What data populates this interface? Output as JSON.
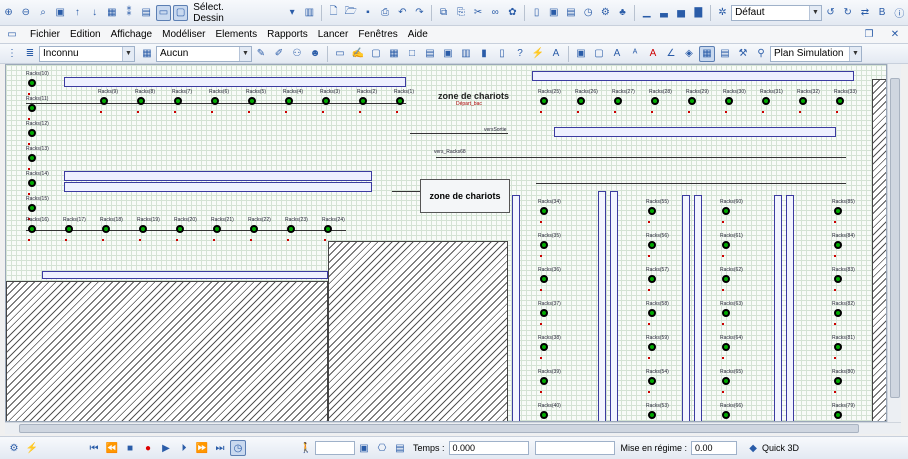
{
  "toolbar1": {
    "select_mode": "Sélect. Dessin",
    "view_combo": "Défaut"
  },
  "menu": [
    "Fichier",
    "Edition",
    "Affichage",
    "Modéliser",
    "Elements",
    "Rapports",
    "Lancer",
    "Fenêtres",
    "Aide"
  ],
  "toolbar2": {
    "layer": "Inconnu",
    "pattern": "Aucun",
    "plan": "Plan Simulation"
  },
  "canvas": {
    "zone_top": "zone de chariots",
    "zone_box": "zone de chariots",
    "label_depart": "Départ_bac",
    "label_vers_sortie": "versSortie",
    "label_vers_racks": "vers_Racks68",
    "left_racks": [
      "Racks(10)",
      "Racks(11)",
      "Racks(12)",
      "Racks(13)",
      "Racks(14)",
      "Racks(15)"
    ],
    "top_row": [
      "Racks(9)",
      "Racks(8)",
      "Racks(7)",
      "Racks(6)",
      "Racks(5)",
      "Racks(4)",
      "Racks(3)",
      "Racks(2)",
      "Racks(1)"
    ],
    "top_right_row": [
      "Racks(25)",
      "Racks(26)",
      "Racks(27)",
      "Racks(28)",
      "Racks(29)",
      "Racks(30)",
      "Racks(31)",
      "Racks(32)",
      "Racks(33)"
    ],
    "mid_row": [
      "Racks(16)",
      "Racks(17)",
      "Racks(18)",
      "Racks(19)",
      "Racks(20)",
      "Racks(21)",
      "Racks(22)",
      "Racks(23)",
      "Racks(24)"
    ],
    "col_a": [
      "Racks(34)",
      "Racks(35)",
      "Racks(36)",
      "Racks(37)",
      "Racks(38)",
      "Racks(39)",
      "Racks(40)"
    ],
    "col_b": [
      "Racks(55)",
      "Racks(56)",
      "Racks(57)",
      "Racks(58)",
      "Racks(59)",
      "Racks(54)",
      "Racks(53)"
    ],
    "col_c": [
      "Racks(60)",
      "Racks(61)",
      "Racks(62)",
      "Racks(63)",
      "Racks(64)",
      "Racks(65)",
      "Racks(66)"
    ],
    "col_d": [
      "Racks(85)",
      "Racks(84)",
      "Racks(83)",
      "Racks(82)",
      "Racks(81)",
      "Racks(80)",
      "Racks(79)"
    ]
  },
  "status": {
    "time_label": "Temps :",
    "time_value": "0.000",
    "warmup_label": "Mise en régime :",
    "warmup_value": "0.00",
    "quick3d": "Quick 3D"
  }
}
